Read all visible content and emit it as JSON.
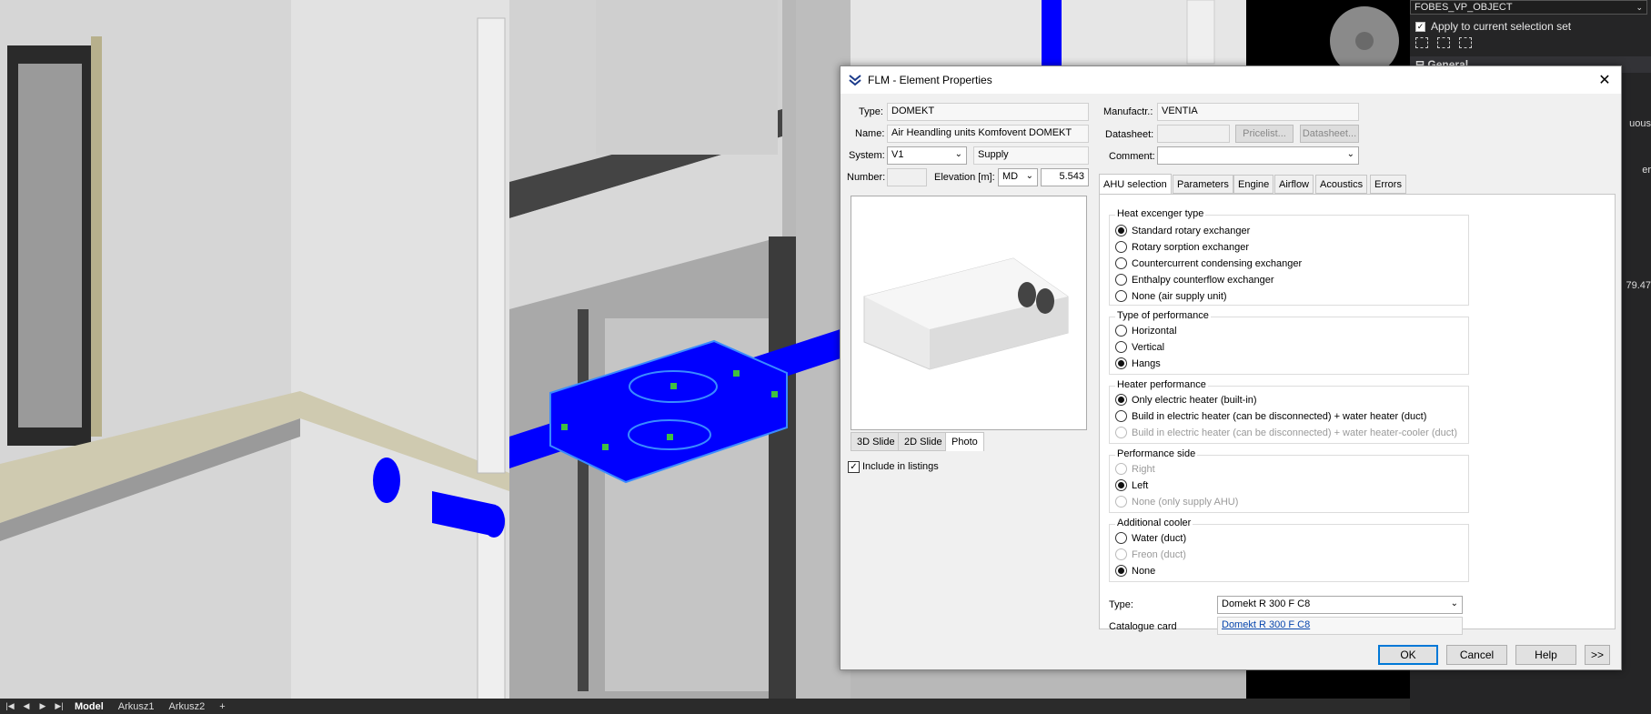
{
  "side_panel": {
    "object_combo": "FOBES_VP_OBJECT",
    "apply_checkbox_label": "Apply to current selection set",
    "section_general": "General",
    "fragments": [
      "uous",
      "er",
      "79.47"
    ]
  },
  "tabbar": {
    "nav_first": "|◀",
    "nav_prev": "◀",
    "nav_next": "▶",
    "nav_last": "▶|",
    "tabs": [
      "Model",
      "Arkusz1",
      "Arkusz2"
    ],
    "add": "+"
  },
  "dialog": {
    "title": "FLM - Element Properties",
    "type_label": "Type:",
    "type_value": "DOMEKT",
    "name_label": "Name:",
    "name_value": "Air Heandling units Komfovent DOMEKT",
    "system_label": "System:",
    "system_value": "V1",
    "system_type_value": "Supply",
    "number_label": "Number:",
    "number_value": "",
    "elevation_label": "Elevation [m]:",
    "elevation_mode": "MD",
    "elevation_value": "5.543",
    "manufacturer_label": "Manufactr.:",
    "manufacturer_value": "VENTIA",
    "datasheet_label": "Datasheet:",
    "datasheet_value": "",
    "pricelist_button": "Pricelist...",
    "datasheet_button": "Datasheet...",
    "comment_label": "Comment:",
    "comment_value": "",
    "view_tabs": [
      "3D Slide",
      "2D Slide",
      "Photo"
    ],
    "include_listings_label": "Include in listings",
    "tabs": [
      "AHU selection",
      "Parameters",
      "Engine",
      "Airflow",
      "Acoustics",
      "Errors"
    ],
    "groups": {
      "heat_exchanger": {
        "title": "Heat excenger type",
        "options": [
          "Standard rotary exchanger",
          "Rotary sorption exchanger",
          "Countercurrent condensing exchanger",
          "Enthalpy counterflow exchanger",
          "None (air supply unit)"
        ],
        "selected": 0
      },
      "performance": {
        "title": "Type of performance",
        "options": [
          "Horizontal",
          "Vertical",
          "Hangs"
        ],
        "selected": 2
      },
      "heater": {
        "title": "Heater performance",
        "options": [
          "Only electric heater (built-in)",
          "Build in electric heater (can be disconnected) + water heater (duct)",
          "Build in electric heater (can be disconnected) + water heater-cooler (duct)"
        ],
        "selected": 0
      },
      "side": {
        "title": "Performance side",
        "options": [
          "Right",
          "Left",
          "None (only supply AHU)"
        ],
        "selected": 1
      },
      "cooler": {
        "title": "Additional cooler",
        "options": [
          "Water (duct)",
          "Freon (duct)",
          "None"
        ],
        "selected": 2
      }
    },
    "type2_label": "Type:",
    "type2_value": "Domekt R 300 F C8",
    "catalogue_label": "Catalogue card",
    "catalogue_value": "Domekt R 300 F C8",
    "ok": "OK",
    "cancel": "Cancel",
    "help": "Help",
    "more": ">>"
  },
  "colors": {
    "duct_blue": "#0000ff",
    "selection_blue": "#1a5cff",
    "grip_green": "#40c040"
  }
}
